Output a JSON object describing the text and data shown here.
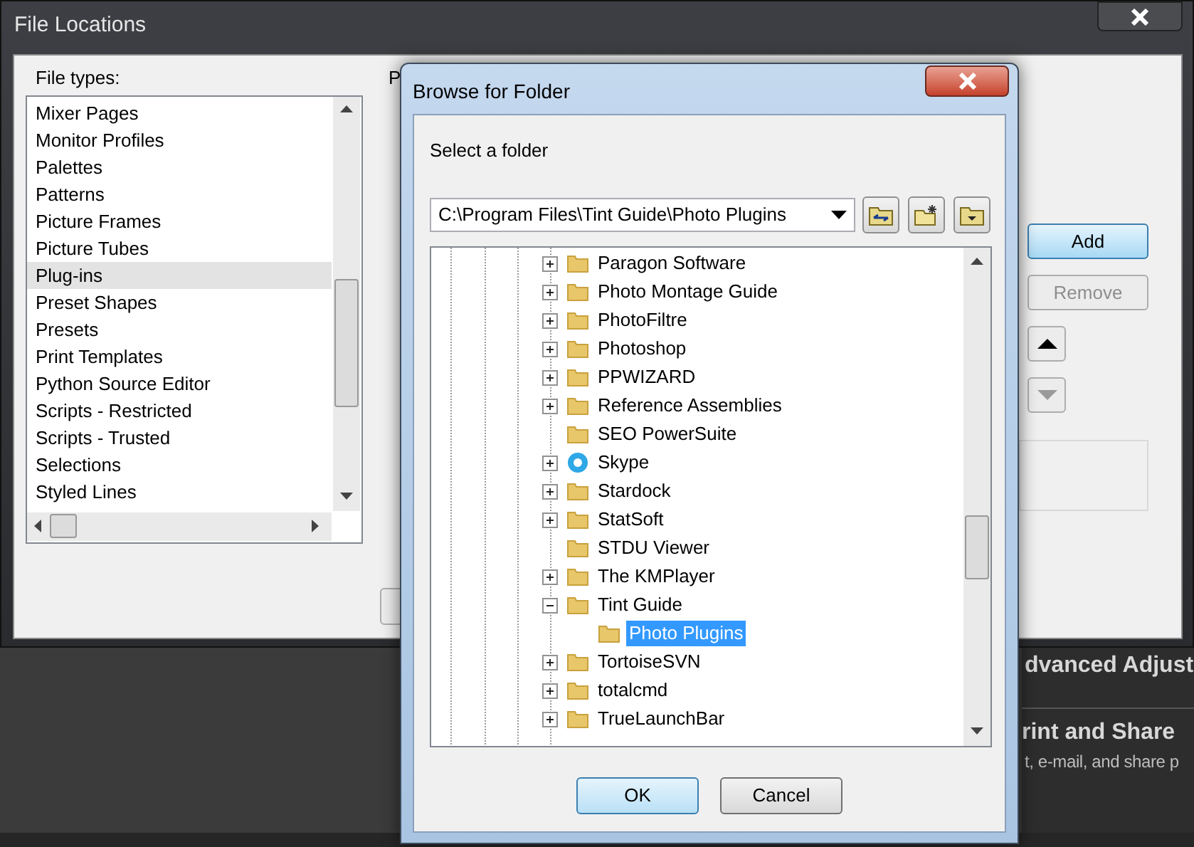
{
  "background_panel": {
    "texts": [
      {
        "kind": "heading",
        "text": "dvanced Adjust"
      },
      {
        "kind": "heading",
        "text": "rint and Share"
      },
      {
        "kind": "caption",
        "text": "t, e-mail, and share p"
      }
    ]
  },
  "file_locations": {
    "title": "File Locations",
    "file_types_label": "File types:",
    "hidden_label": "P",
    "file_types": [
      {
        "label": "Mixer Pages",
        "selected": false
      },
      {
        "label": "Monitor Profiles",
        "selected": false
      },
      {
        "label": "Palettes",
        "selected": false
      },
      {
        "label": "Patterns",
        "selected": false
      },
      {
        "label": "Picture Frames",
        "selected": false
      },
      {
        "label": "Picture Tubes",
        "selected": false
      },
      {
        "label": "Plug-ins",
        "selected": true
      },
      {
        "label": "Preset Shapes",
        "selected": false
      },
      {
        "label": "Presets",
        "selected": false
      },
      {
        "label": "Print Templates",
        "selected": false
      },
      {
        "label": "Python Source Editor",
        "selected": false
      },
      {
        "label": "Scripts - Restricted",
        "selected": false
      },
      {
        "label": "Scripts - Trusted",
        "selected": false
      },
      {
        "label": "Selections",
        "selected": false
      },
      {
        "label": "Styled Lines",
        "selected": false
      }
    ],
    "buttons": [
      {
        "kind": "text",
        "label": "Add",
        "default": true,
        "disabled": false
      },
      {
        "kind": "text",
        "label": "Remove",
        "default": false,
        "disabled": true
      },
      {
        "kind": "up",
        "default": false,
        "disabled": false
      },
      {
        "kind": "down",
        "default": false,
        "disabled": true
      }
    ]
  },
  "browse_dialog": {
    "title": "Browse for Folder",
    "prompt": "Select a folder",
    "path": {
      "value": "C:\\Program Files\\Tint Guide\\Photo Plugins"
    },
    "tree": [
      {
        "label": "Paragon Software",
        "kind": "folder",
        "expandable": true,
        "expanded": false,
        "selected": false
      },
      {
        "label": "Photo Montage Guide",
        "kind": "folder",
        "expandable": true,
        "expanded": false,
        "selected": false
      },
      {
        "label": "PhotoFiltre",
        "kind": "folder",
        "expandable": true,
        "expanded": false,
        "selected": false
      },
      {
        "label": "Photoshop",
        "kind": "folder",
        "expandable": true,
        "expanded": false,
        "selected": false
      },
      {
        "label": "PPWIZARD",
        "kind": "folder",
        "expandable": true,
        "expanded": false,
        "selected": false
      },
      {
        "label": "Reference Assemblies",
        "kind": "folder",
        "expandable": true,
        "expanded": false,
        "selected": false
      },
      {
        "label": "SEO PowerSuite",
        "kind": "folder",
        "expandable": false,
        "selected": false
      },
      {
        "label": "Skype",
        "kind": "app",
        "expandable": true,
        "expanded": false,
        "selected": false
      },
      {
        "label": "Stardock",
        "kind": "folder",
        "expandable": true,
        "expanded": false,
        "selected": false
      },
      {
        "label": "StatSoft",
        "kind": "folder",
        "expandable": true,
        "expanded": false,
        "selected": false
      },
      {
        "label": "STDU Viewer",
        "kind": "folder",
        "expandable": false,
        "selected": false
      },
      {
        "label": "The KMPlayer",
        "kind": "folder",
        "expandable": true,
        "expanded": false,
        "selected": false
      },
      {
        "label": "Tint Guide",
        "kind": "folder",
        "expandable": true,
        "expanded": true,
        "selected": false,
        "children": [
          {
            "label": "Photo Plugins",
            "kind": "folder",
            "expandable": false,
            "selected": true
          }
        ]
      },
      {
        "label": "TortoiseSVN",
        "kind": "folder",
        "expandable": true,
        "expanded": false,
        "selected": false
      },
      {
        "label": "totalcmd",
        "kind": "folder",
        "expandable": true,
        "expanded": false,
        "selected": false
      },
      {
        "label": "TrueLaunchBar",
        "kind": "folder",
        "expandable": true,
        "expanded": false,
        "selected": false
      }
    ],
    "buttons": [
      {
        "label": "OK",
        "default": true
      },
      {
        "label": "Cancel",
        "default": false
      }
    ]
  }
}
